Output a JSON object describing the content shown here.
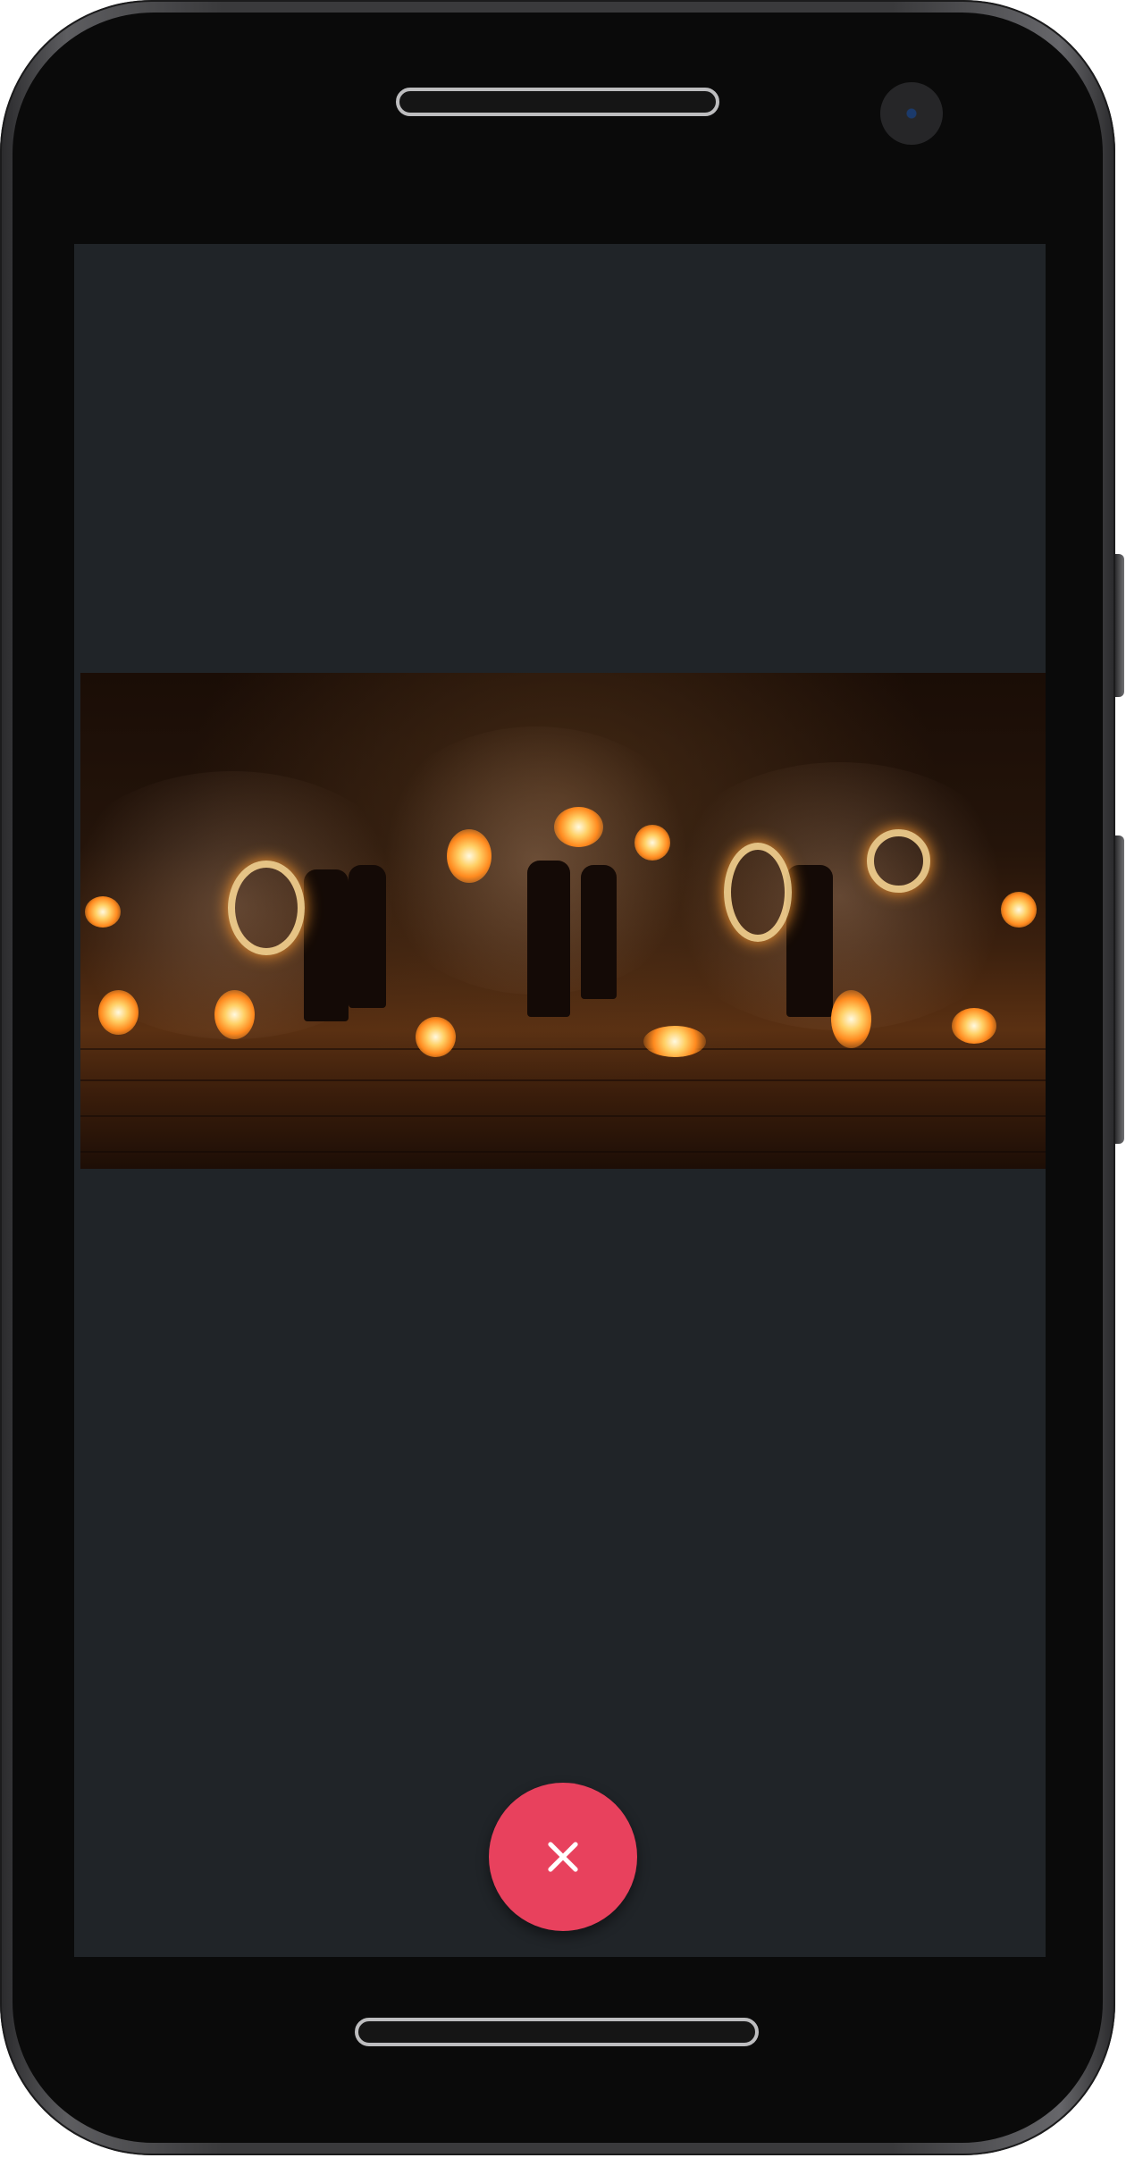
{
  "device": {
    "frame_color": "#3a3a3c",
    "screen_color": "#202428"
  },
  "player": {
    "media": "fire-show-video-frame",
    "close_button": {
      "icon": "close-icon",
      "color": "#e8415d"
    }
  }
}
